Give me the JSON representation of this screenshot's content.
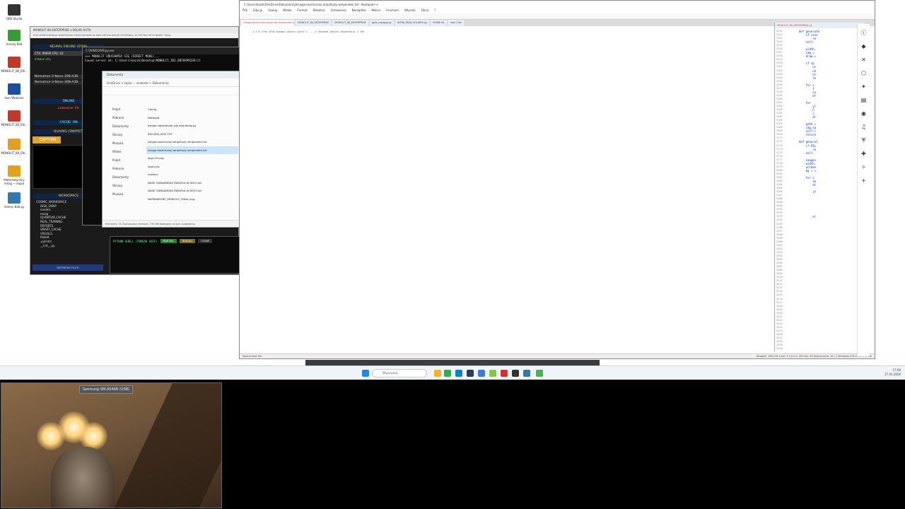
{
  "desktop": {
    "icons": [
      {
        "label": "OBS Studio",
        "color": "#333333"
      },
      {
        "label": "money Bab",
        "color": "#3a9a3a"
      },
      {
        "label": "MONOLIT_IBI_EN...",
        "color": "#c0392b"
      },
      {
        "label": "Ivan Webcam",
        "color": "#1b4f9c"
      },
      {
        "label": "MONOLIT_IBI_EN...",
        "color": "#c0392b"
      },
      {
        "label": "MONOLIT_IBI_EN...",
        "color": "#e0a020"
      },
      {
        "label": "Matematyczny mózg — kopia",
        "color": "#e0a020"
      },
      {
        "label": "money Bab.py",
        "color": "#3776ab"
      }
    ]
  },
  "control_panel": {
    "title": "MONOLIT IBI ENTERPRISE v.SOLAR AUTH",
    "menu": "PLIK  KONFIGURACJA  NARZĘDZIA  ZARZĄDZANIE  KLAWA  AKTUALIZACJE  EXTERNAL_AI  OPTYKA  HELP  RADIO  Tryby",
    "neural_engine": "NEURAL ENGINE (STAB)",
    "ctx": "CTX: 99999  CPU: 16",
    "stable": "STABLE (PS)",
    "models": [
      "Nemotron-3-Nano-30B-A3B",
      "Nemotron-3-Nano-30B-A3B"
    ],
    "online": "ONLINE",
    "loading": "Ladowanie: 0%",
    "cache": "CACHE: ON",
    "quarks": "QUARKS (SNIPPET)",
    "capture": "CAPTURE",
    "workspace": "WORKSPACE",
    "tree": [
      "COSMIC_WORKSPACE",
      "DISK_SWAP",
      "models",
      "mozg",
      "QUANTUM_CACHE",
      "REAL_TRAINING",
      "REPORTS",
      "SMART_CACHE",
      "VISUALS",
      "flake8",
      ".pylintrc",
      "__init__.py"
    ],
    "refresh": "REFRESH FILES"
  },
  "console": {
    "title": "C:\\WINDOWS\\py.exe",
    "lines": [
      ">>> MONOLIT URUCHAMIA SIĘ (DIRECT MODE)...",
      "Found server at: C:\\Users\\kazik\\Desktop\\MONOLIT_IBI_ENTERPRISE\\ll"
    ]
  },
  "explorer": {
    "tab": "Dokumenty",
    "address": "OneDrive  >  kopie — osobiste  >  Dokumenty",
    "nav": [
      "Pulpit",
      "Pobrane",
      "Dokumenty",
      "Obrazy",
      "Muzyka",
      "Wideo",
      "Pulpit",
      "Pobrane",
      "Dokumenty",
      "Obrazy",
      "Muzyka"
    ],
    "files": [
      {
        "name": "Camig",
        "selected": false
      },
      {
        "name": "Notepad",
        "selected": false
      },
      {
        "name": "księga największej siły amplitudy.py",
        "selected": false
      },
      {
        "name": "KSIĄŻKA_KOD.TXT",
        "selected": false
      },
      {
        "name": "księga kosmicznej amplitudy wmpenden.txt",
        "selected": false
      },
      {
        "name": "księga kosmicznej amplitudy wmpenden.txt",
        "selected": true
      },
      {
        "name": "logo.23.png",
        "selected": false
      },
      {
        "name": "logo.png",
        "selected": false
      },
      {
        "name": "noweco",
        "selected": false
      },
      {
        "name": "NASE ODNAJDENIA ŚWIATŁA W SIECI.txt",
        "selected": false
      },
      {
        "name": "NASE ODNAJDENIA ŚWIATŁA W SIECI.txt",
        "selected": false
      },
      {
        "name": "NAPRAWIONY_MONOLIT_FINAL.png",
        "selected": false
      }
    ],
    "status": "Elementy: 35    Zaznaczony element: 735 KB    Dostępny na tym urządzeniu"
  },
  "python_shell": {
    "title": "PYTHON SHELL (THREAD SAFE)",
    "buttons": [
      {
        "label": "RUN SEL",
        "color": "#2f7d3a"
      },
      {
        "label": "RUN ALL",
        "color": "#7d6a2f"
      },
      {
        "label": "CLEAR",
        "color": "#333333"
      }
    ]
  },
  "notepad": {
    "title": "C:\\Users\\kazik\\OneDrive\\Dokumenty\\księga kosmicznej amplitudy wmpenden.txt - Notepad++",
    "menu": [
      "Plik",
      "Edycja",
      "Szukaj",
      "Widok",
      "Format",
      "Składnia",
      "Ustawienia",
      "Narzędzia",
      "Makra",
      "Uruchom",
      "Wtyczki",
      "Okna",
      "?"
    ],
    "tabs": [
      {
        "label": "księga kosmicznej amplitudy wmpenden.txt",
        "active": true
      },
      {
        "label": "MONOLIT_IBI_ENTERPRISE",
        "active": false
      },
      {
        "label": "MONOLIT_IBI_ENTERPRISE",
        "active": false
      },
      {
        "label": "gpt4_mozgpy.py",
        "active": false
      },
      {
        "label": "ULTRA_FAZA_SOLARIO.py",
        "active": false
      },
      {
        "label": "NOWE.txt",
        "active": false
      },
      {
        "label": "new 1.txt",
        "active": false
      }
    ],
    "editor_line": "1  Z A sfen 2016 kosmos zbiory wiele i ... Z okienek danych otwierania i teh",
    "pane2_tab": "MONOLIT_IBI_ENTERPRISE.py",
    "line_numbers": [
      "3141",
      "3142",
      "3143",
      "3144",
      "3145",
      "3146",
      "3147",
      "3148",
      "3149",
      "3150",
      "3151",
      "3152",
      "3153",
      "3154",
      "3155",
      "3156",
      "3157",
      "3158",
      "3159",
      "3160",
      "3161",
      "3162",
      "3163",
      "3164",
      "3165",
      "3166",
      "3167",
      "3168",
      "3169",
      "3170",
      "3171",
      "3172",
      "3173",
      "3174",
      "3175",
      "3176",
      "3177",
      "3178",
      "3179",
      "3180",
      "3181",
      "3182",
      "3183",
      "3184",
      "3185",
      "3186",
      "3187",
      "3188",
      "3189",
      "3190",
      "3191",
      "3192",
      "3193",
      "3194",
      "3195",
      "3196",
      "3197",
      "3198",
      "3199",
      "3200",
      "3201",
      "3202",
      "3203",
      "3204",
      "3205",
      "3206",
      "3207",
      "3208",
      "3209",
      "3210",
      "3211",
      "3212",
      "3213",
      "3214",
      "3215",
      "3216",
      "3217",
      "3218",
      "3219",
      "3220",
      "3221",
      "3222",
      "3223",
      "3224",
      "3225",
      "3226",
      "3227",
      "3228",
      "3229",
      "3230"
    ],
    "code_lines": [
      "def generate",
      "    if size",
      "        re",
      "    self.",
      "",
      "    width,",
      "    img =",
      "    draw =",
      "",
      "    if sp",
      "        nc",
      "        no",
      "        nt",
      "        le",
      "",
      "    for i",
      "        t",
      "        co",
      "        dr",
      "",
      "    for",
      "        yl",
      "        h",
      "        c",
      "        dr",
      "",
      "    path =",
      "    img.sa",
      "    self.l",
      "    return",
      "",
      "def generat",
      "    if PIL",
      "        re",
      "    self.",
      "",
      "    images",
      "    width,",
      "    octave",
      "    bg = c",
      "",
      "    for i",
      "        im",
      "        dr",
      "",
      "        if",
      "",
      "",
      "",
      "",
      "",
      "",
      "        el"
    ],
    "status_left": "Normal text file",
    "status_right": "Długość: 186,216   Linie: 3 141      Ln: 450   Kol: 59   Zaznaczone: 16 | 1      Windows (CR LF)   UTF-8   INS"
  },
  "sidebar_icons": [
    "info-icon",
    "copilot-icon",
    "close-icon",
    "extension-icon",
    "pin-icon",
    "clipboard-icon",
    "chat-icon",
    "audio-icon",
    "shield-icon",
    "tools-icon",
    "sparkle-icon",
    "add-icon"
  ],
  "taskbar": {
    "search_placeholder": "Wyszukaj",
    "clock_time": "17:00",
    "clock_date": "17.01.2026",
    "apps": [
      {
        "name": "start-icon",
        "color": "#1e88e5"
      },
      {
        "name": "file-explorer-icon",
        "color": "#f2b134"
      },
      {
        "name": "chrome-icon",
        "color": "#34a853"
      },
      {
        "name": "edge-icon",
        "color": "#0f7bd1"
      },
      {
        "name": "terminal-icon",
        "color": "#2b3a55"
      },
      {
        "name": "vscode-icon",
        "color": "#3a7bd5"
      },
      {
        "name": "notepadpp-icon",
        "color": "#8bc34a"
      },
      {
        "name": "opera-icon",
        "color": "#d32f2f"
      },
      {
        "name": "obs-icon",
        "color": "#333333"
      },
      {
        "name": "python-icon",
        "color": "#3776ab"
      },
      {
        "name": "green-app-icon",
        "color": "#4caf50"
      }
    ]
  },
  "webcam": {
    "label": "Samsung SM-A546B (USB)"
  }
}
